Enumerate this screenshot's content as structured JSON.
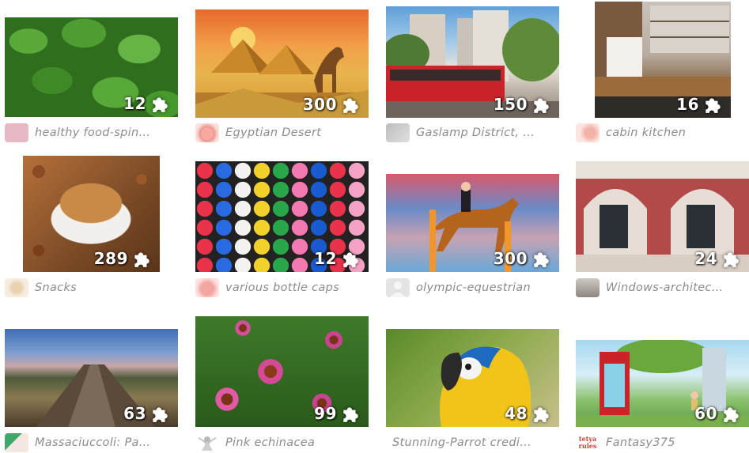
{
  "puzzles": [
    {
      "title": "healthy food-spin…",
      "pieces": "12",
      "avatar_color": "#e7b9c4",
      "art": "spinach"
    },
    {
      "title": "Egyptian Desert",
      "pieces": "300",
      "avatar_color": "#e98f8a",
      "art": "desert"
    },
    {
      "title": "Gaslamp District, …",
      "pieces": "150",
      "avatar_color": "#c9c9c9",
      "art": "city"
    },
    {
      "title": "cabin kitchen",
      "pieces": "16",
      "avatar_color": "#f6d6d0",
      "art": "kitchen"
    },
    {
      "title": "Snacks",
      "pieces": "289",
      "avatar_color": "#f2e6d2",
      "art": "snacks"
    },
    {
      "title": "various bottle caps",
      "pieces": "12",
      "avatar_color": "#f0a3a0",
      "art": "caps"
    },
    {
      "title": "olympic-equestrian",
      "pieces": "300",
      "avatar_color": "#dddddd",
      "art": "horse"
    },
    {
      "title": "Windows-architec…",
      "pieces": "24",
      "avatar_color": "#a8a39e",
      "art": "arch"
    },
    {
      "title": "Massaciuccoli: Pa…",
      "pieces": "63",
      "avatar_color": "#e07a6e",
      "art": "pier"
    },
    {
      "title": "Pink echinacea",
      "pieces": "99",
      "avatar_color": "#d9d9d9",
      "art": "flowers"
    },
    {
      "title": "Stunning-Parrot credi…",
      "pieces": "48",
      "avatar_color": "",
      "art": "parrot"
    },
    {
      "title": "Fantasy375",
      "pieces": "60",
      "avatar_color": "#ffffff",
      "art": "fantasy",
      "avatar_text": "tetya rules"
    }
  ]
}
